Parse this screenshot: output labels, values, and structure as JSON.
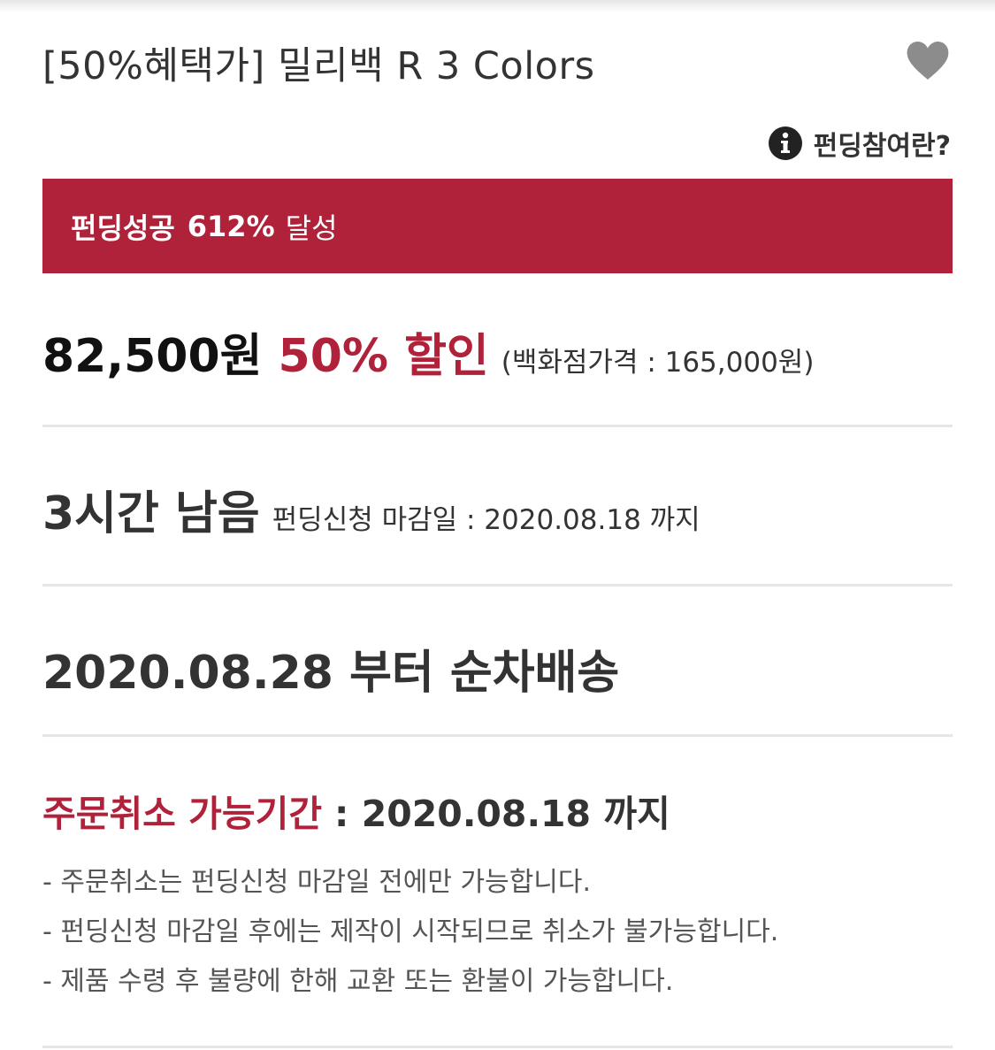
{
  "product": {
    "title": "[50%혜택가] 밀리백 R 3 Colors"
  },
  "icons": {
    "wishlist": "heart-icon",
    "info": "info-icon"
  },
  "funding_info": {
    "label": "펀딩참여란?"
  },
  "funding_status": {
    "label": "펀딩성공",
    "percent": "612%",
    "suffix": "달성",
    "bg_color": "#b0223a"
  },
  "price": {
    "sale_price": "82,500원",
    "discount": "50% 할인",
    "department_price": "(백화점가격 : 165,000원)"
  },
  "remaining": {
    "time_left": "3시간 남음",
    "deadline": "펀딩신청 마감일 : 2020.08.18 까지"
  },
  "delivery": {
    "text": "2020.08.28 부터 순차배송"
  },
  "cancellation": {
    "label": "주문취소 가능기간",
    "date": ": 2020.08.18 까지",
    "notes": [
      "- 주문취소는 펀딩신청 마감일 전에만 가능합니다.",
      "- 펀딩신청 마감일 후에는 제작이 시작되므로 취소가 불가능합니다.",
      "- 제품 수령 후 불량에 한해 교환 또는 환불이 가능합니다."
    ]
  },
  "colors": {
    "accent": "#b0223a",
    "text": "#333333",
    "heart": "#8c8c8c",
    "divider": "#e6e6e6"
  }
}
